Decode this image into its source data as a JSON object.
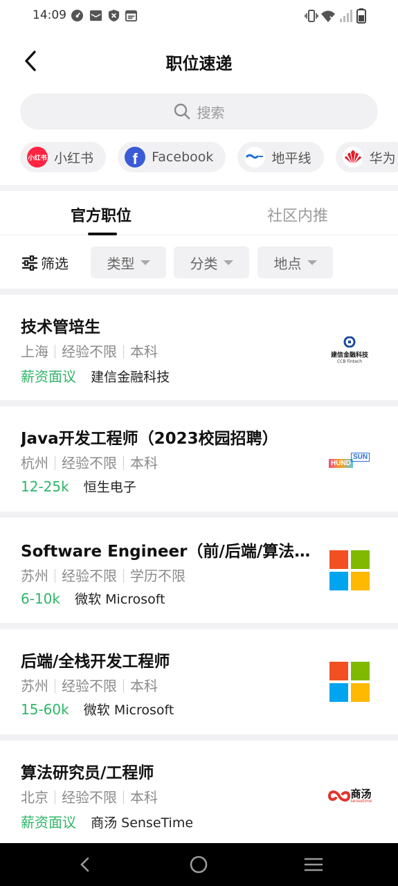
{
  "status_bar": {
    "time": "14:09",
    "left_icons": [
      "speedometer-icon",
      "mail-icon",
      "shield-icon",
      "calendar-icon"
    ],
    "right_icons": [
      "vibrate-icon",
      "wifi-icon",
      "signal-icon",
      "battery-icon"
    ]
  },
  "header": {
    "title": "职位速递",
    "back_icon": "chevron-left-icon"
  },
  "search": {
    "placeholder": "搜索",
    "icon": "search-icon"
  },
  "company_chips": [
    {
      "label": "小红书",
      "logo_text": "小红书",
      "color": "#ff2442"
    },
    {
      "label": "Facebook",
      "logo_text": "f",
      "color": "#3b5bd6"
    },
    {
      "label": "地平线",
      "logo_text": "地平线",
      "color": "#1e6fd9"
    },
    {
      "label": "华为",
      "logo_text": "",
      "color": "#e01e2b"
    }
  ],
  "tabs": [
    {
      "label": "官方职位",
      "active": true
    },
    {
      "label": "社区内推",
      "active": false
    }
  ],
  "filters": {
    "main_label": "筛选",
    "dropdowns": [
      "类型",
      "分类",
      "地点"
    ]
  },
  "jobs": [
    {
      "title": "技术管培生",
      "city": "上海",
      "experience": "经验不限",
      "education": "本科",
      "salary": "薪资面议",
      "company": "建信金融科技",
      "logo": {
        "type": "ccb",
        "text": "建信金融科技",
        "subtext": "CCB Fintech"
      }
    },
    {
      "title": "Java开发工程师（2023校园招聘）",
      "city": "杭州",
      "experience": "经验不限",
      "education": "本科",
      "salary": "12-25k",
      "company": "恒生电子",
      "logo": {
        "type": "hundsun",
        "text": "HUND",
        "subtext": "SUN"
      }
    },
    {
      "title": "Software Engineer（前/后端/算法工程…",
      "city": "苏州",
      "experience": "经验不限",
      "education": "学历不限",
      "salary": "6-10k",
      "company": "微软 Microsoft",
      "logo": {
        "type": "microsoft",
        "text": "",
        "subtext": ""
      }
    },
    {
      "title": "后端/全栈开发工程师",
      "city": "苏州",
      "experience": "经验不限",
      "education": "本科",
      "salary": "15-60k",
      "company": "微软 Microsoft",
      "logo": {
        "type": "microsoft",
        "text": "",
        "subtext": ""
      }
    },
    {
      "title": "算法研究员/工程师",
      "city": "北京",
      "experience": "经验不限",
      "education": "本科",
      "salary": "薪资面议",
      "company": "商汤 SenseTime",
      "logo": {
        "type": "sensetime",
        "text": "商汤",
        "subtext": "sensetime"
      }
    }
  ],
  "colors": {
    "salary_green": "#2fb568",
    "chip_bg": "#f1f1f3",
    "nav_bg": "#000000"
  },
  "nav_bar": {
    "icons": [
      "back-icon",
      "home-icon",
      "menu-icon"
    ]
  }
}
